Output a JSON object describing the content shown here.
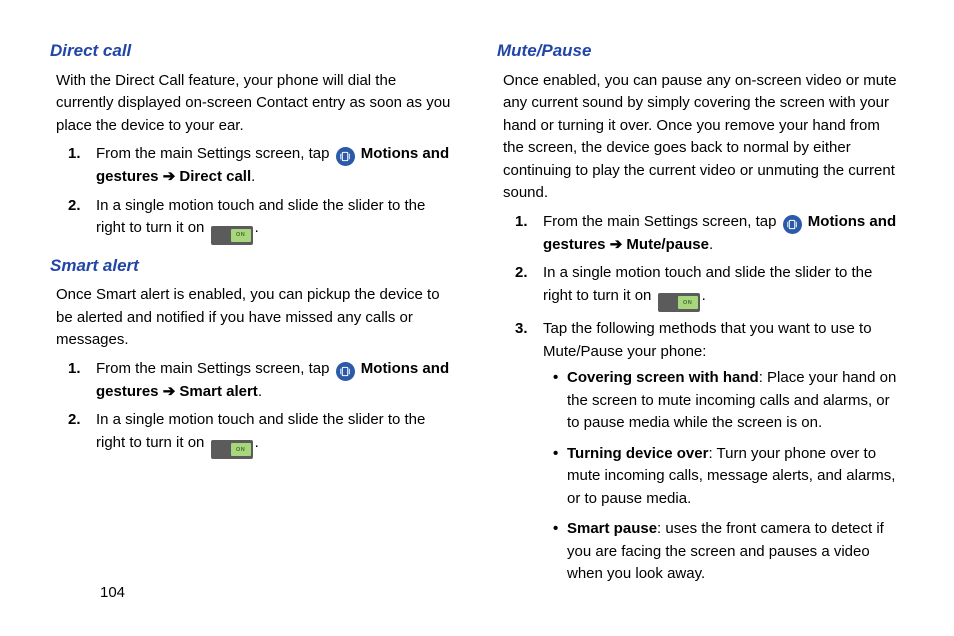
{
  "page_number": "104",
  "left": {
    "s1": {
      "title": "Direct call",
      "intro": "With the Direct Call feature, your phone will dial the currently displayed on-screen Contact entry as soon as you place the device to your ear.",
      "step1_a": "From the main Settings screen, tap ",
      "step1_b": "Motions and gestures ➔ Direct call",
      "step1_c": ".",
      "step2_a": "In a single motion touch and slide the slider to the right to turn it on ",
      "step2_c": "."
    },
    "s2": {
      "title": "Smart alert",
      "intro": "Once Smart alert is enabled, you can pickup the device to be alerted and notified if you have missed any calls or messages.",
      "step1_a": "From the main Settings screen, tap ",
      "step1_b": "Motions and gestures ➔ Smart alert",
      "step1_c": ".",
      "step2_a": "In a single motion touch and slide the slider to the right to turn it on ",
      "step2_c": "."
    }
  },
  "right": {
    "s1": {
      "title": "Mute/Pause",
      "intro": "Once enabled, you can pause any on-screen video or mute any current sound by simply covering the screen with your hand or turning it over. Once you remove your hand from the screen, the device goes back to normal by either continuing to play the current video or unmuting the current sound.",
      "step1_a": "From the main Settings screen, tap ",
      "step1_b": "Motions and gestures ➔ Mute/pause",
      "step1_c": ".",
      "step2_a": "In a single motion touch and slide the slider to the right to turn it on ",
      "step2_c": ".",
      "step3": "Tap the following methods that you want to use to Mute/Pause your phone:",
      "b1_t": "Covering screen with hand",
      "b1_r": ": Place your hand on the screen to mute incoming calls and alarms, or to pause media while the screen is on.",
      "b2_t": "Turning device over",
      "b2_r": ": Turn your phone over to mute incoming calls, message alerts, and alarms, or to pause media.",
      "b3_t": "Smart pause",
      "b3_r": ": uses the front camera to detect if you are facing the screen and pauses a video when you look away."
    }
  },
  "toggle_label": "ON"
}
